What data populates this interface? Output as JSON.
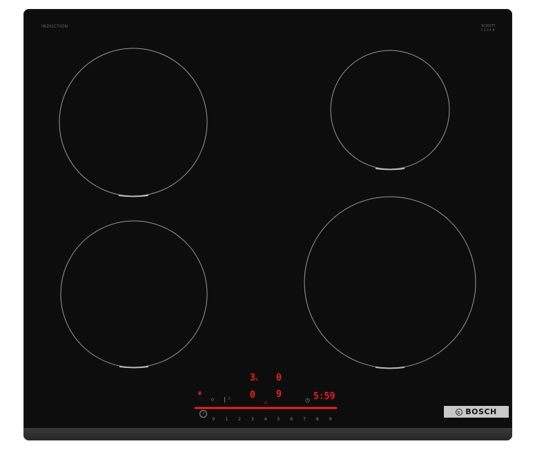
{
  "cooktop": {
    "brand_top_left": "INDUCTION",
    "brand_top_left_sub": "",
    "brand_top_right_line1": "SCHOTT",
    "brand_top_right_line2": "CERAN",
    "brand_top_right_sub": "",
    "badge_text": "BOSCH",
    "display": {
      "top_left_value": "3",
      "top_left_suffix": "s",
      "top_right_value": "0",
      "mid_left_value": "0",
      "mid_right_value": "9",
      "timer_value": "5:59",
      "wifi_label": "",
      "power_label": "0"
    },
    "slider_scale": [
      "0",
      "1",
      "2",
      "3",
      "4",
      "5",
      "6",
      "7",
      "8",
      "9"
    ]
  },
  "colors": {
    "glass": "#0d0d0d",
    "display_red": "#ff2a2a",
    "zone_outline": "#9a9a9a",
    "badge_bg": "#c8c8c8"
  }
}
